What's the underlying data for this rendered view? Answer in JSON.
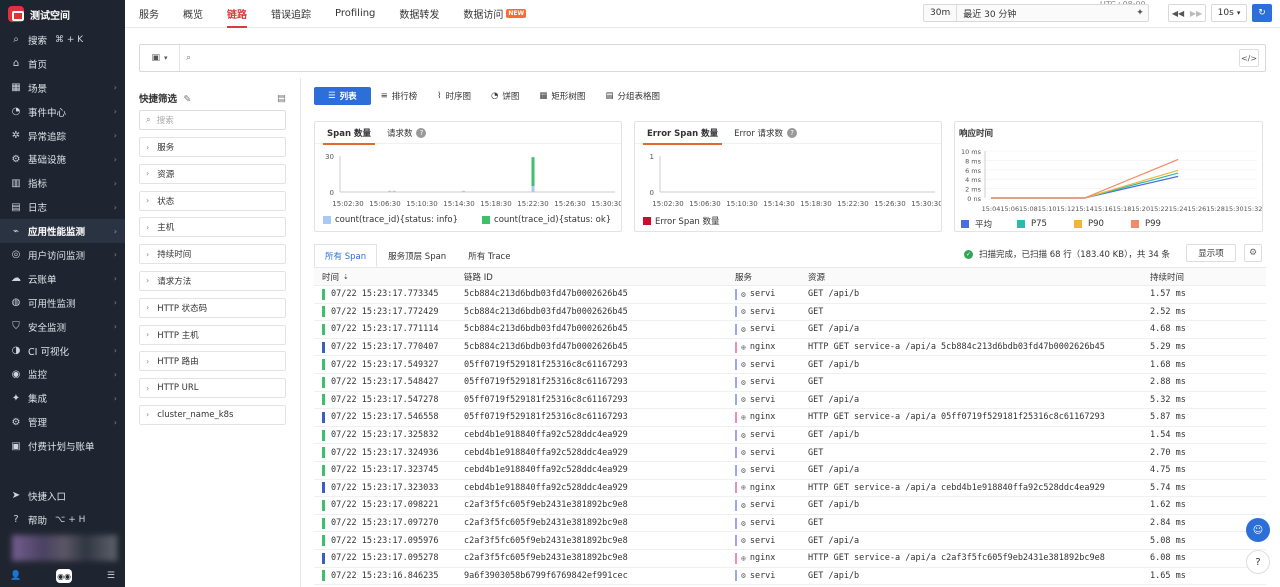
{
  "app": {
    "workspace": "测试空间",
    "timezone": "UTC+08:00"
  },
  "sidebar": {
    "search": {
      "label": "搜索",
      "shortcut": "⌘ + K"
    },
    "items": [
      {
        "label": "首页",
        "icon": "home-icon",
        "arrow": false
      },
      {
        "label": "场景",
        "icon": "grid-icon",
        "arrow": true
      },
      {
        "label": "事件中心",
        "icon": "bell-icon",
        "arrow": true
      },
      {
        "label": "异常追踪",
        "icon": "bug-icon",
        "arrow": true
      },
      {
        "label": "基础设施",
        "icon": "server-icon",
        "arrow": true
      },
      {
        "label": "指标",
        "icon": "chart-icon",
        "arrow": true
      },
      {
        "label": "日志",
        "icon": "log-icon",
        "arrow": true
      },
      {
        "label": "应用性能监测",
        "icon": "apm-icon",
        "arrow": true,
        "active": true
      },
      {
        "label": "用户访问监测",
        "icon": "user-monitor-icon",
        "arrow": true
      },
      {
        "label": "云账单",
        "icon": "cloud-bill-icon",
        "arrow": true
      },
      {
        "label": "可用性监测",
        "icon": "availability-icon",
        "arrow": true
      },
      {
        "label": "安全监测",
        "icon": "shield-icon",
        "arrow": true
      },
      {
        "label": "CI 可视化",
        "icon": "ci-icon",
        "arrow": true
      },
      {
        "label": "监控",
        "icon": "monitor-icon",
        "arrow": true
      },
      {
        "label": "集成",
        "icon": "integration-icon",
        "arrow": true
      },
      {
        "label": "管理",
        "icon": "settings-icon",
        "arrow": true
      },
      {
        "label": "付费计划与账单",
        "icon": "billing-icon",
        "arrow": false
      }
    ],
    "quick_entry": "快捷入口",
    "help": {
      "label": "帮助",
      "shortcut": "⌥ + H"
    }
  },
  "topnav": {
    "tabs": [
      "服务",
      "概览",
      "链路",
      "错误追踪",
      "Profiling",
      "数据转发",
      "数据访问"
    ],
    "active_index": 2,
    "new_badge": "NEW"
  },
  "time": {
    "range_short": "30m",
    "range_label": "最近 30 分钟",
    "refresh_interval": "10s"
  },
  "quick_filter": {
    "title": "快捷筛选",
    "search_placeholder": "搜索",
    "items": [
      "服务",
      "资源",
      "状态",
      "主机",
      "持续时间",
      "请求方法",
      "HTTP 状态码",
      "HTTP 主机",
      "HTTP 路由",
      "HTTP URL",
      "cluster_name_k8s"
    ]
  },
  "view_tabs": [
    "列表",
    "排行榜",
    "时序图",
    "饼图",
    "矩形树图",
    "分组表格图"
  ],
  "span_chart": {
    "tabs": [
      "Span 数量",
      "请求数"
    ],
    "legend": [
      "count(trace_id){status: info}",
      "count(trace_id){status: ok}"
    ],
    "colors": [
      "#a9c8f5",
      "#3fbf6b"
    ]
  },
  "error_chart": {
    "tabs": [
      "Error Span 数量",
      "Error 请求数"
    ],
    "legend": [
      "Error Span 数量"
    ],
    "colors": [
      "#c8102e"
    ]
  },
  "latency_chart": {
    "title": "响应时间",
    "legend": [
      "平均",
      "P75",
      "P90",
      "P99"
    ],
    "colors": [
      "#4a6ee0",
      "#2bbbad",
      "#f2b53a",
      "#f28a6a"
    ]
  },
  "chart_data": [
    {
      "type": "bar",
      "title": "Span 数量",
      "ylim": [
        0,
        30
      ],
      "yticks": [
        "30",
        "0"
      ],
      "xticks": [
        "15:02:30",
        "15:06:30",
        "15:10:30",
        "15:14:30",
        "15:18:30",
        "15:22:30",
        "15:26:30",
        "15:30:30"
      ],
      "series": [
        {
          "name": "count(trace_id){status: info}",
          "x": [
            "15:07:00",
            "15:07:30",
            "15:15:00",
            "15:22:30"
          ],
          "values": [
            1,
            1,
            1,
            5
          ]
        },
        {
          "name": "count(trace_id){status: ok}",
          "x": [
            "15:22:30"
          ],
          "values": [
            24
          ]
        }
      ]
    },
    {
      "type": "bar",
      "title": "Error Span 数量",
      "ylim": [
        0,
        1
      ],
      "yticks": [
        "1",
        "0"
      ],
      "xticks": [
        "15:02:30",
        "15:06:30",
        "15:10:30",
        "15:14:30",
        "15:18:30",
        "15:22:30",
        "15:26:30",
        "15:30:30"
      ],
      "series": [
        {
          "name": "Error Span 数量",
          "values": []
        }
      ]
    },
    {
      "type": "line",
      "title": "响应时间",
      "ylim": [
        0,
        10
      ],
      "yticks": [
        "10 ms",
        "8 ms",
        "6 ms",
        "4 ms",
        "2 ms",
        "0 ns"
      ],
      "xticks": [
        "15:04",
        "15:06",
        "15:08",
        "15:10",
        "15:12",
        "15:14",
        "15:16",
        "15:18",
        "15:20",
        "15:22",
        "15:24",
        "15:26",
        "15:28",
        "15:30",
        "15:32"
      ],
      "x": [
        "15:04",
        "15:14",
        "15:24"
      ],
      "series": [
        {
          "name": "平均",
          "values": [
            0,
            0,
            4.6
          ]
        },
        {
          "name": "P75",
          "values": [
            0,
            0,
            5.3
          ]
        },
        {
          "name": "P90",
          "values": [
            0,
            0,
            5.9
          ]
        },
        {
          "name": "P99",
          "values": [
            0,
            0,
            8.2
          ]
        }
      ]
    }
  ],
  "table_tabs": [
    "所有 Span",
    "服务顶层 Span",
    "所有 Trace"
  ],
  "scan": {
    "text": "扫描完成，已扫描 68 行（183.40 KB），共 34 条",
    "show_button": "显示项"
  },
  "table": {
    "headers": [
      "时间",
      "链路 ID",
      "服务",
      "资源",
      "持续时间"
    ],
    "rows": [
      {
        "time": "07/22 15:23:17.773345",
        "trace_id": "5cb884c213d6bdb03fd47b0002626b45",
        "service": "servi",
        "resource": "GET /api/b",
        "duration": "1.57 ms",
        "kind": "svc"
      },
      {
        "time": "07/22 15:23:17.772429",
        "trace_id": "5cb884c213d6bdb03fd47b0002626b45",
        "service": "servi",
        "resource": "GET",
        "duration": "2.52 ms",
        "kind": "svc"
      },
      {
        "time": "07/22 15:23:17.771114",
        "trace_id": "5cb884c213d6bdb03fd47b0002626b45",
        "service": "servi",
        "resource": "GET /api/a",
        "duration": "4.68 ms",
        "kind": "svc"
      },
      {
        "time": "07/22 15:23:17.770407",
        "trace_id": "5cb884c213d6bdb03fd47b0002626b45",
        "service": "nginx",
        "resource": "HTTP GET service-a /api/a 5cb884c213d6bdb03fd47b0002626b45",
        "duration": "5.29 ms",
        "kind": "nginx"
      },
      {
        "time": "07/22 15:23:17.549327",
        "trace_id": "05ff0719f529181f25316c8c61167293",
        "service": "servi",
        "resource": "GET /api/b",
        "duration": "1.68 ms",
        "kind": "svc"
      },
      {
        "time": "07/22 15:23:17.548427",
        "trace_id": "05ff0719f529181f25316c8c61167293",
        "service": "servi",
        "resource": "GET",
        "duration": "2.88 ms",
        "kind": "svc"
      },
      {
        "time": "07/22 15:23:17.547278",
        "trace_id": "05ff0719f529181f25316c8c61167293",
        "service": "servi",
        "resource": "GET /api/a",
        "duration": "5.32 ms",
        "kind": "svc"
      },
      {
        "time": "07/22 15:23:17.546558",
        "trace_id": "05ff0719f529181f25316c8c61167293",
        "service": "nginx",
        "resource": "HTTP GET service-a /api/a 05ff0719f529181f25316c8c61167293",
        "duration": "5.87 ms",
        "kind": "nginx"
      },
      {
        "time": "07/22 15:23:17.325832",
        "trace_id": "cebd4b1e918840ffa92c528ddc4ea929",
        "service": "servi",
        "resource": "GET /api/b",
        "duration": "1.54 ms",
        "kind": "svc"
      },
      {
        "time": "07/22 15:23:17.324936",
        "trace_id": "cebd4b1e918840ffa92c528ddc4ea929",
        "service": "servi",
        "resource": "GET",
        "duration": "2.70 ms",
        "kind": "svc"
      },
      {
        "time": "07/22 15:23:17.323745",
        "trace_id": "cebd4b1e918840ffa92c528ddc4ea929",
        "service": "servi",
        "resource": "GET /api/a",
        "duration": "4.75 ms",
        "kind": "svc"
      },
      {
        "time": "07/22 15:23:17.323033",
        "trace_id": "cebd4b1e918840ffa92c528ddc4ea929",
        "service": "nginx",
        "resource": "HTTP GET service-a /api/a cebd4b1e918840ffa92c528ddc4ea929",
        "duration": "5.74 ms",
        "kind": "nginx"
      },
      {
        "time": "07/22 15:23:17.098221",
        "trace_id": "c2af3f5fc605f9eb2431e381892bc9e8",
        "service": "servi",
        "resource": "GET /api/b",
        "duration": "1.62 ms",
        "kind": "svc"
      },
      {
        "time": "07/22 15:23:17.097270",
        "trace_id": "c2af3f5fc605f9eb2431e381892bc9e8",
        "service": "servi",
        "resource": "GET",
        "duration": "2.84 ms",
        "kind": "svc"
      },
      {
        "time": "07/22 15:23:17.095976",
        "trace_id": "c2af3f5fc605f9eb2431e381892bc9e8",
        "service": "servi",
        "resource": "GET /api/a",
        "duration": "5.08 ms",
        "kind": "svc"
      },
      {
        "time": "07/22 15:23:17.095278",
        "trace_id": "c2af3f5fc605f9eb2431e381892bc9e8",
        "service": "nginx",
        "resource": "HTTP GET service-a /api/a c2af3f5fc605f9eb2431e381892bc9e8",
        "duration": "6.08 ms",
        "kind": "nginx"
      },
      {
        "time": "07/22 15:23:16.846235",
        "trace_id": "9a6f3903058b6799f6769842ef991cec",
        "service": "servi",
        "resource": "GET /api/b",
        "duration": "1.65 ms",
        "kind": "svc"
      }
    ]
  }
}
